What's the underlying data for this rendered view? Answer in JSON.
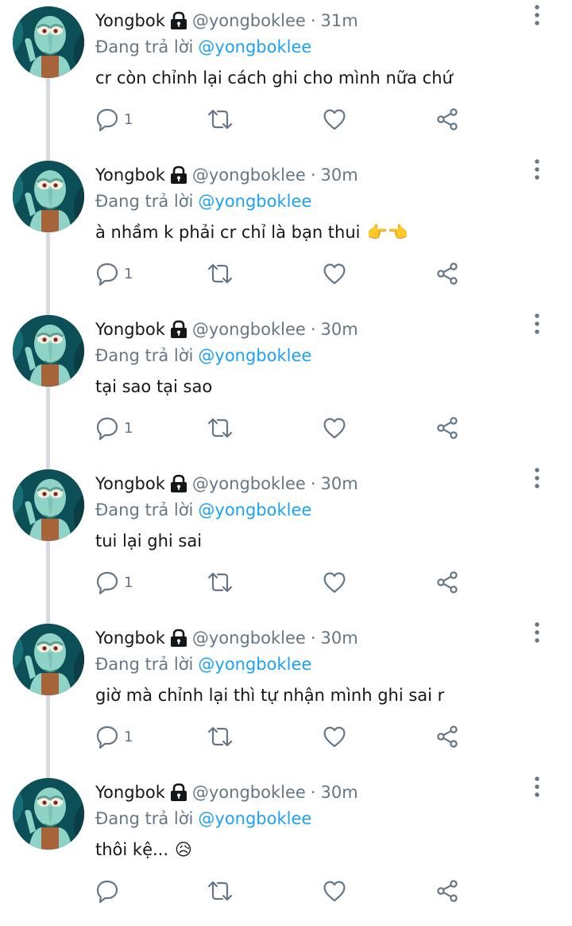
{
  "colors": {
    "text": "#14171a",
    "muted": "#657786",
    "link": "#1da1f2",
    "thread_line": "#d7dbdf",
    "background": "#ffffff"
  },
  "icons": {
    "lock": "lock-icon",
    "more": "more-vertical-icon",
    "reply": "reply-icon",
    "retweet": "retweet-icon",
    "like": "heart-icon",
    "share": "share-icon"
  },
  "tweets": [
    {
      "name": "Yongbok",
      "handle": "@yongboklee",
      "separator": "·",
      "time": "31m",
      "reply_prefix": "Đang trả lời",
      "reply_to": "@yongboklee",
      "text": "cr còn chỉnh lại cách ghi cho mình nữa chứ",
      "emoji": "",
      "reply_count": "1"
    },
    {
      "name": "Yongbok",
      "handle": "@yongboklee",
      "separator": "·",
      "time": "30m",
      "reply_prefix": "Đang trả lời",
      "reply_to": "@yongboklee",
      "text": "à nhầm k phải cr chỉ là bạn thui",
      "emoji": "👉👈",
      "reply_count": "1"
    },
    {
      "name": "Yongbok",
      "handle": "@yongboklee",
      "separator": "·",
      "time": "30m",
      "reply_prefix": "Đang trả lời",
      "reply_to": "@yongboklee",
      "text": "tại sao tại sao",
      "emoji": "",
      "reply_count": "1"
    },
    {
      "name": "Yongbok",
      "handle": "@yongboklee",
      "separator": "·",
      "time": "30m",
      "reply_prefix": "Đang trả lời",
      "reply_to": "@yongboklee",
      "text": "tui lại ghi sai",
      "emoji": "",
      "reply_count": "1"
    },
    {
      "name": "Yongbok",
      "handle": "@yongboklee",
      "separator": "·",
      "time": "30m",
      "reply_prefix": "Đang trả lời",
      "reply_to": "@yongboklee",
      "text": "giờ mà chỉnh lại thì tự nhận mình ghi sai r",
      "emoji": "",
      "reply_count": "1"
    },
    {
      "name": "Yongbok",
      "handle": "@yongboklee",
      "separator": "·",
      "time": "30m",
      "reply_prefix": "Đang trả lời",
      "reply_to": "@yongboklee",
      "text": "thôi kệ...",
      "emoji": "😥",
      "reply_count": ""
    }
  ]
}
